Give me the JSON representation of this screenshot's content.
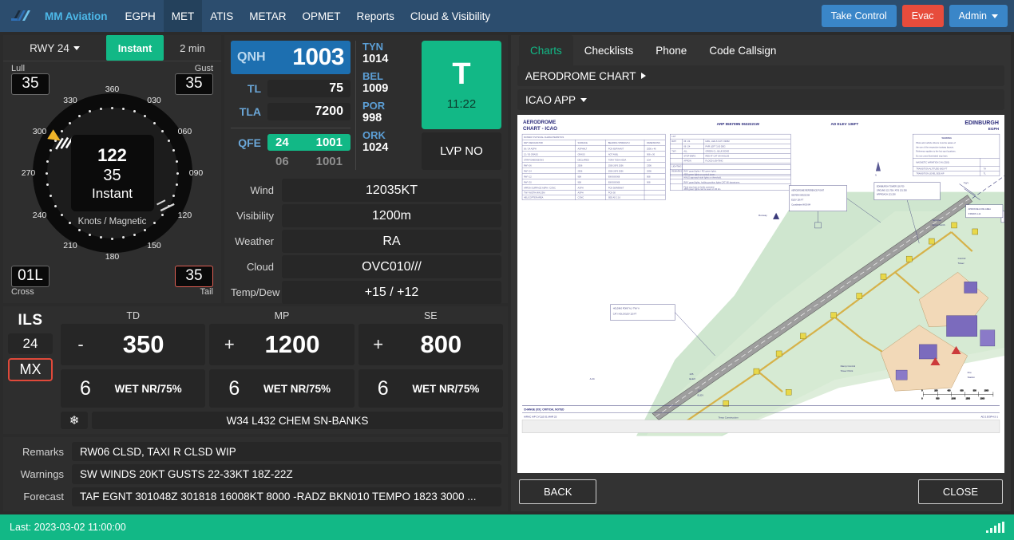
{
  "nav": {
    "logo_icon": "slashes-logo-icon",
    "brand": "MM Aviation",
    "items": [
      {
        "label": "EGPH",
        "active": false
      },
      {
        "label": "MET",
        "active": true
      },
      {
        "label": "ATIS",
        "active": false
      },
      {
        "label": "METAR",
        "active": false
      },
      {
        "label": "OPMET",
        "active": false
      },
      {
        "label": "Reports",
        "active": false
      },
      {
        "label": "Cloud & Visibility",
        "active": false
      }
    ],
    "take_control": "Take Control",
    "evac": "Evac",
    "admin": "Admin"
  },
  "wind": {
    "runway_select": "RWY 24",
    "mode_instant": "Instant",
    "mode_2min": "2 min",
    "lull_label": "Lull",
    "lull_value": "35",
    "gust_label": "Gust",
    "gust_value": "35",
    "cross_label": "Cross",
    "cross_value": "01L",
    "tail_label": "Tail",
    "tail_value": "35",
    "direction": "122",
    "speed": "35",
    "mode": "Instant",
    "units": "Knots / Magnetic",
    "tick_labels": [
      "360",
      "030",
      "060",
      "090",
      "120",
      "150",
      "180",
      "210",
      "240",
      "270",
      "300",
      "330"
    ],
    "arrow_bearing_deg": 122
  },
  "pressure": {
    "qnh_label": "QNH",
    "qnh_value": "1003",
    "tl_label": "TL",
    "tl_value": "75",
    "tla_label": "TLA",
    "tla_value": "7200",
    "qfe_label": "QFE",
    "qfe_primary_rwy": "24",
    "qfe_primary_value": "1001",
    "qfe_secondary_rwy": "06",
    "qfe_secondary_value": "1001",
    "stations": [
      {
        "name": "TYN",
        "value": "1014"
      },
      {
        "name": "BEL",
        "value": "1009"
      },
      {
        "name": "POR",
        "value": "998"
      },
      {
        "name": "ORK",
        "value": "1024"
      }
    ],
    "t_letter": "T",
    "t_time": "11:22",
    "lvp": "LVP NO"
  },
  "metar": {
    "rows": [
      {
        "key": "Wind",
        "value": "12035KT"
      },
      {
        "key": "Visibility",
        "value": "1200m"
      },
      {
        "key": "Weather",
        "value": "RA"
      },
      {
        "key": "Cloud",
        "value": "OVC010///"
      },
      {
        "key": "Temp/Dew",
        "value": "+15 / +12"
      }
    ]
  },
  "ils": {
    "title": "ILS",
    "runway": "24",
    "status": "MX"
  },
  "runway_state": {
    "sections": [
      {
        "header": "TD",
        "sign": "-",
        "value": "350",
        "code": "6",
        "desc": "WET NR/75%"
      },
      {
        "header": "MP",
        "sign": "+",
        "value": "1200",
        "code": "6",
        "desc": "WET NR/75%"
      },
      {
        "header": "SE",
        "sign": "+",
        "value": "800",
        "code": "6",
        "desc": "WET NR/75%"
      }
    ],
    "chem_icon": "snowflake-icon",
    "chem_text": "W34 L432 CHEM SN-BANKS"
  },
  "notes": {
    "rows": [
      {
        "key": "Remarks",
        "value": "RW06 CLSD, TAXI R CLSD WIP"
      },
      {
        "key": "Warnings",
        "value": "SW WINDS 20KT GUSTS 22-33KT 18Z-22Z"
      },
      {
        "key": "Forecast",
        "value": "TAF EGNT 301048Z 301818 16008KT 8000 -RADZ BKN010 TEMPO 1823 3000 ..."
      }
    ]
  },
  "rightpanel": {
    "tabs": [
      {
        "label": "Charts",
        "active": true
      },
      {
        "label": "Checklists",
        "active": false
      },
      {
        "label": "Phone",
        "active": false
      },
      {
        "label": "Code Callsign",
        "active": false
      }
    ],
    "chart_bars": [
      {
        "label": "AERODROME CHART",
        "caret": "right"
      },
      {
        "label": "ICAO APP",
        "caret": "down"
      }
    ],
    "back_label": "BACK",
    "close_label": "CLOSE"
  },
  "aerodrome_chart": {
    "title_line1": "AERODROME",
    "title_line2": "CHART - ICAO",
    "arp": "ARP 555709N 0632221W",
    "ad_elev": "AD ELEV 136FT",
    "airport_name": "EDINBURGH",
    "airport_icao": "EGPH",
    "footer_left": "CHANGE (XX): CRITICAL NOTED",
    "footer_sub": "AIRAC AIP CYCLE 01 MAR 23",
    "footer_right": "AD 2.EGPH-2-1"
  },
  "statusbar": {
    "last_label": "Last: 2023-03-02 11:00:00",
    "signal_icon": "signal-bars-icon"
  },
  "colors": {
    "nav_bg": "#2c4d6e",
    "brand": "#4db8e8",
    "accent_green": "#12b886",
    "accent_blue": "#1d6fb0",
    "danger_red": "#e74c3c",
    "panel_bg": "#2e2e2e",
    "field_bg": "#272727"
  }
}
